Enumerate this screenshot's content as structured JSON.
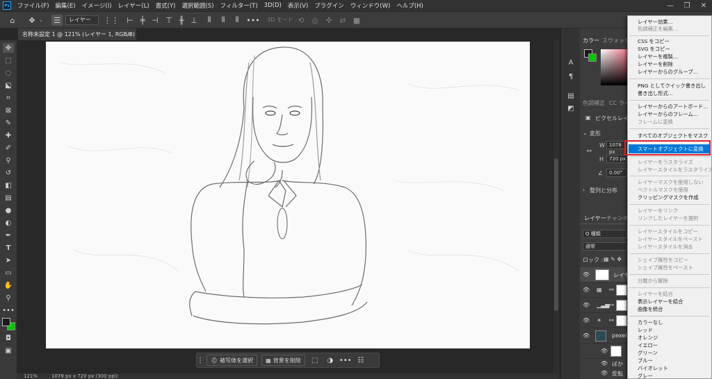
{
  "menubar": {
    "items": [
      "ファイル(F)",
      "編集(E)",
      "イメージ(I)",
      "レイヤー(L)",
      "書式(Y)",
      "選択範囲(S)",
      "フィルター(T)",
      "3D(D)",
      "表示(V)",
      "プラグイン",
      "ウィンドウ(W)",
      "ヘルプ(H)"
    ],
    "logo": "Ps"
  },
  "options": {
    "layer_select": "レイヤー",
    "mode3d": "3D モード :"
  },
  "document": {
    "tab_title": "名称未設定 1 @ 121% (レイヤー 1, RGB/8) *",
    "close": "×"
  },
  "taskbar": {
    "select_subject": "被写体を選択",
    "remove_bg": "背景を削除",
    "more": "•••"
  },
  "status": {
    "zoom": "121%",
    "doc_info": "1078 px x 720 px (300 ppi)"
  },
  "panels": {
    "color_tab": "カラー",
    "swatches_tab": "スウォッチ",
    "adjust_tab": "色調補正",
    "cc_tab": "CC ライ",
    "pixel_layer": "ピクセルレイヤ",
    "transform": "変形",
    "w_label": "W",
    "w_value": "1078 px",
    "h_label": "H",
    "h_value": "720 px",
    "angle": "0.00°",
    "align": "整列と分布",
    "layers_tab": "レイヤー",
    "channels_tab": "チャンネル",
    "search_kind": "Q 種類",
    "blend_mode": "通常",
    "lock_label": "ロック :",
    "layer1_name": "レイヤ",
    "layer_pexels": "pexels",
    "sub1": "ぼか",
    "sub2": "反転"
  },
  "context_menu": {
    "items": [
      {
        "label": "レイヤー効果...",
        "disabled": false
      },
      {
        "label": "色調補正を編集...",
        "disabled": true
      },
      {
        "label": "CSS をコピー",
        "disabled": false
      },
      {
        "label": "SVG をコピー",
        "disabled": false
      },
      {
        "label": "レイヤーを複製...",
        "disabled": false
      },
      {
        "label": "レイヤーを削除",
        "disabled": false
      },
      {
        "label": "レイヤーからのグループ...",
        "disabled": false
      },
      {
        "label": "PNG としてクイック書き出し",
        "disabled": false
      },
      {
        "label": "書き出し形式...",
        "disabled": false
      },
      {
        "label": "レイヤーからのアートボード...",
        "disabled": false
      },
      {
        "label": "レイヤーからのフレーム...",
        "disabled": false
      },
      {
        "label": "フレームに変換",
        "disabled": true
      },
      {
        "label": "すべてのオブジェクトをマスク",
        "disabled": false
      },
      {
        "label": "スマートオブジェクトに変換",
        "disabled": false,
        "highlighted": true
      },
      {
        "label": "レイヤーをラスタライズ",
        "disabled": true
      },
      {
        "label": "レイヤースタイルをラスタライズ",
        "disabled": true
      },
      {
        "label": "レイヤーマスクを使用しない",
        "disabled": true
      },
      {
        "label": "ベクトルマスクを使用",
        "disabled": true
      },
      {
        "label": "クリッピングマスクを作成",
        "disabled": false
      },
      {
        "label": "レイヤーをリンク",
        "disabled": true
      },
      {
        "label": "リンクしたレイヤーを選択",
        "disabled": true
      },
      {
        "label": "レイヤースタイルをコピー",
        "disabled": true
      },
      {
        "label": "レイヤースタイルをペースト",
        "disabled": true
      },
      {
        "label": "レイヤースタイルを消去",
        "disabled": true
      },
      {
        "label": "シェイプ属性をコピー",
        "disabled": true
      },
      {
        "label": "シェイプ属性をペースト",
        "disabled": true
      },
      {
        "label": "分離から解除",
        "disabled": true
      },
      {
        "label": "レイヤーを結合",
        "disabled": true
      },
      {
        "label": "表示レイヤーを結合",
        "disabled": false
      },
      {
        "label": "画像を統合",
        "disabled": false
      },
      {
        "label": "カラーなし",
        "disabled": false
      },
      {
        "label": "レッド",
        "disabled": false
      },
      {
        "label": "オレンジ",
        "disabled": false
      },
      {
        "label": "イエロー",
        "disabled": false
      },
      {
        "label": "グリーン",
        "disabled": false
      },
      {
        "label": "ブルー",
        "disabled": false
      },
      {
        "label": "バイオレット",
        "disabled": false
      },
      {
        "label": "グレー",
        "disabled": false
      }
    ]
  },
  "colors": {
    "highlight": "#0078d7",
    "annotation_box": "#e0202a",
    "foreground": "#1a1a1a",
    "background": "#00c800"
  }
}
